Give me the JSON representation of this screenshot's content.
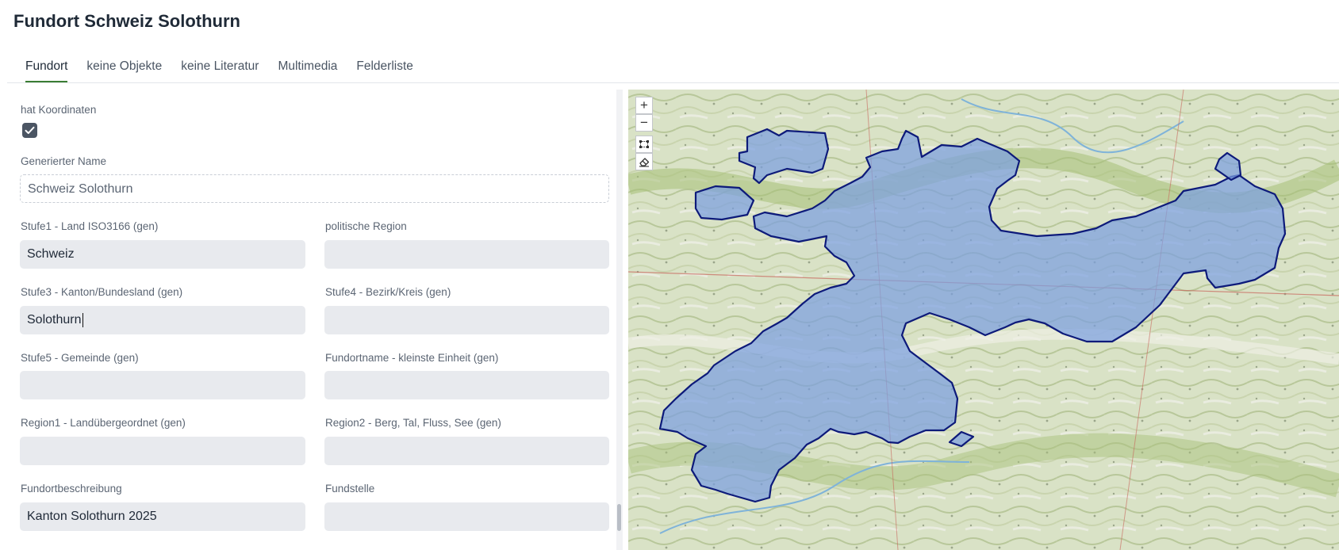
{
  "page": {
    "title": "Fundort Schweiz Solothurn"
  },
  "tabs": [
    {
      "label": "Fundort",
      "active": true
    },
    {
      "label": "keine Objekte",
      "active": false
    },
    {
      "label": "keine Literatur",
      "active": false
    },
    {
      "label": "Multimedia",
      "active": false
    },
    {
      "label": "Felderliste",
      "active": false
    }
  ],
  "form": {
    "has_coordinates": {
      "label": "hat Koordinaten",
      "checked": true
    },
    "generated_name": {
      "label": "Generierter Name",
      "value": "Schweiz Solothurn"
    },
    "level1": {
      "label": "Stufe1 - Land ISO3166 (gen)",
      "value": "Schweiz"
    },
    "political_region": {
      "label": "politische Region",
      "value": ""
    },
    "level3": {
      "label": "Stufe3 - Kanton/Bundesland (gen)",
      "value": "Solothurn"
    },
    "level4": {
      "label": "Stufe4 - Bezirk/Kreis (gen)",
      "value": ""
    },
    "level5": {
      "label": "Stufe5 - Gemeinde (gen)",
      "value": ""
    },
    "site_name": {
      "label": "Fundortname - kleinste Einheit (gen)",
      "value": ""
    },
    "region1": {
      "label": "Region1 - Landübergeordnet (gen)",
      "value": ""
    },
    "region2": {
      "label": "Region2 - Berg, Tal, Fluss, See (gen)",
      "value": ""
    },
    "description": {
      "label": "Fundortbeschreibung",
      "value": "Kanton Solothurn 2025"
    },
    "fundstelle": {
      "label": "Fundstelle",
      "value": ""
    }
  },
  "map": {
    "controls": {
      "zoom_in": "+",
      "zoom_out": "−",
      "draw_icon": "draw-polygon-icon",
      "erase_icon": "eraser-icon"
    },
    "colors": {
      "polygon_fill": "#7b9fe0",
      "polygon_stroke": "#0d1a7a",
      "accent": "#3a7d33"
    }
  }
}
